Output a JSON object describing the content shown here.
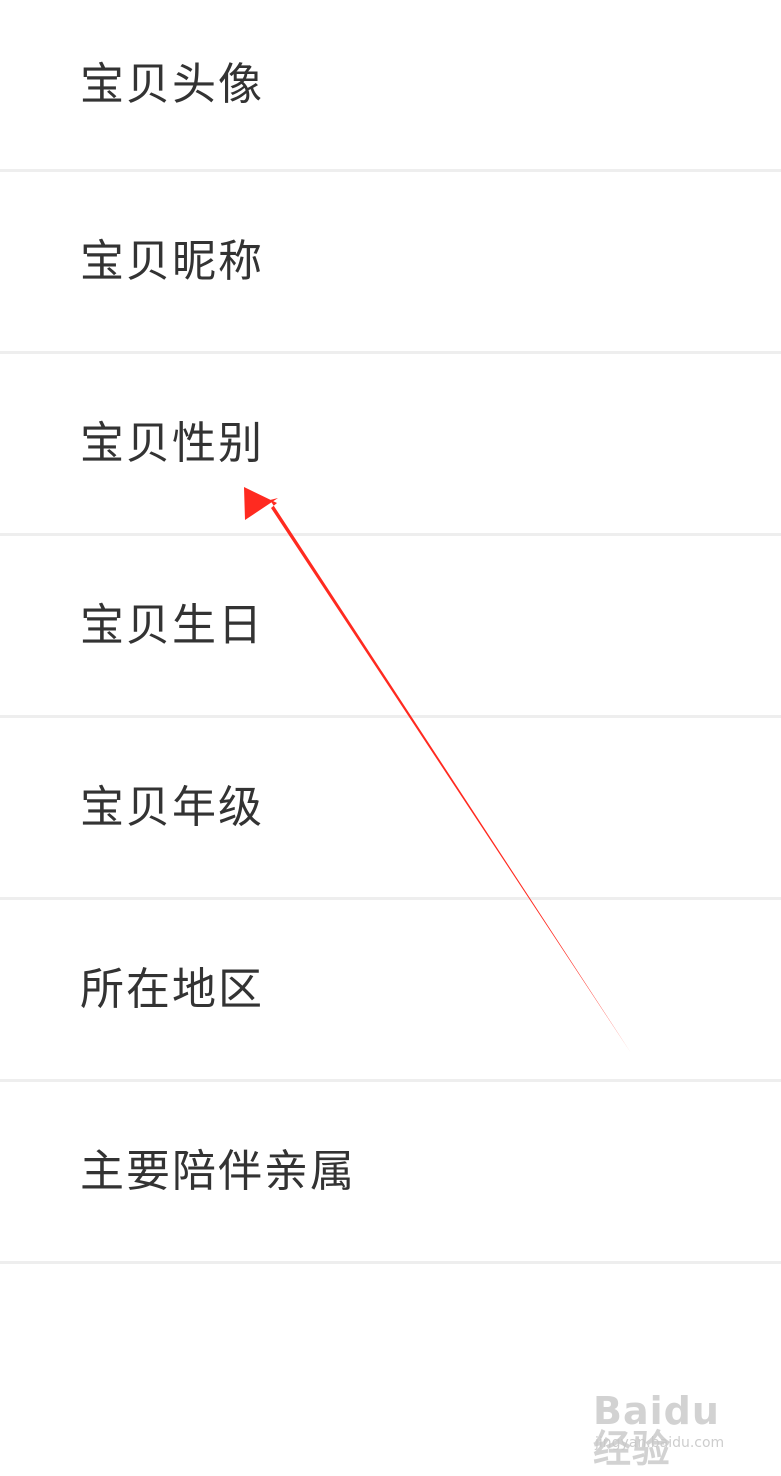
{
  "settings": {
    "rows": [
      {
        "label": "宝贝头像"
      },
      {
        "label": "宝贝昵称"
      },
      {
        "label": "宝贝性别"
      },
      {
        "label": "宝贝生日"
      },
      {
        "label": "宝贝年级"
      },
      {
        "label": "所在地区"
      },
      {
        "label": "主要陪伴亲属"
      }
    ]
  },
  "annotation": {
    "type": "arrow",
    "color": "#ff2a20",
    "points_to": "宝贝性别"
  },
  "watermark": {
    "logo_text": "Baidu经验",
    "url_text": "jingyan.baidu.com"
  },
  "colors": {
    "background": "#ffffff",
    "label_text": "#333333",
    "divider": "#eeeeee"
  }
}
